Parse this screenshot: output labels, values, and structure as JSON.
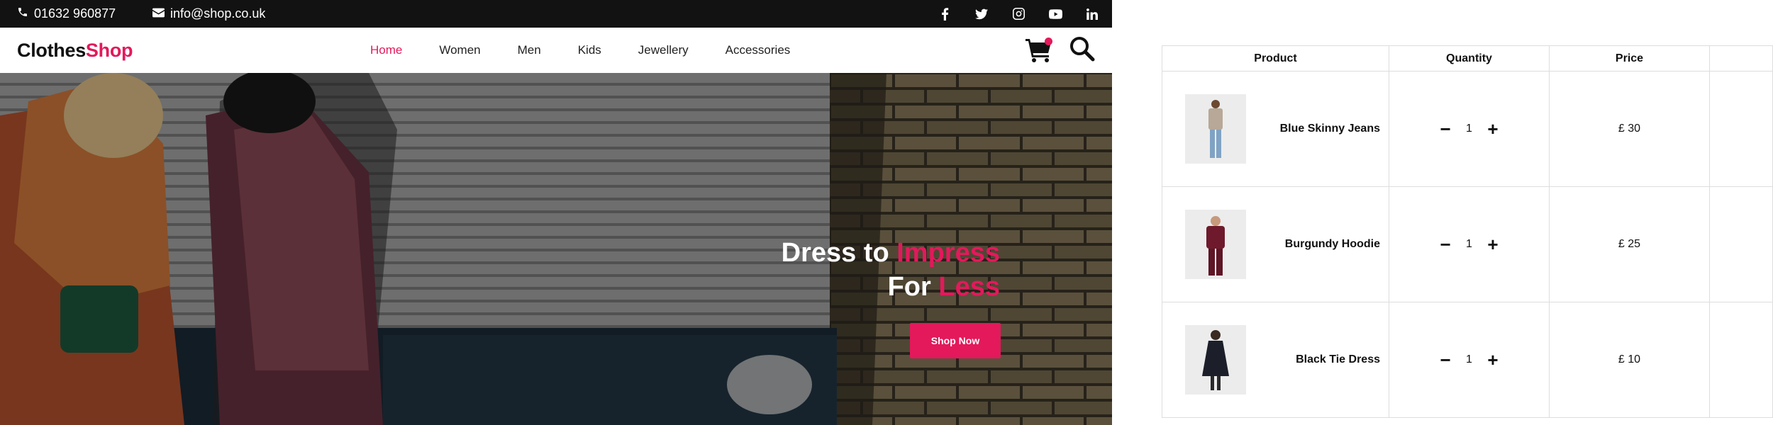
{
  "topbar": {
    "phone": "01632 960877",
    "email": "info@shop.co.uk",
    "social_icons": [
      "facebook-icon",
      "twitter-icon",
      "instagram-icon",
      "youtube-icon",
      "linkedin-icon"
    ]
  },
  "navbar": {
    "logo_part1": "Clothes",
    "logo_part2": "Shop",
    "menu": [
      "Home",
      "Women",
      "Men",
      "Kids",
      "Jewellery",
      "Accessories"
    ],
    "active": "Home"
  },
  "hero": {
    "line1_plain": "Dress to ",
    "line1_accent": "Impress",
    "line2_plain": "For ",
    "line2_accent": "Less",
    "button": "Shop Now"
  },
  "cart": {
    "headers": {
      "product": "Product",
      "quantity": "Quantity",
      "price": "Price"
    },
    "items": [
      {
        "name": "Blue Skinny Jeans",
        "qty": "1",
        "price": "£ 30"
      },
      {
        "name": "Burgundy Hoodie",
        "qty": "1",
        "price": "£ 25"
      },
      {
        "name": "Black Tie Dress",
        "qty": "1",
        "price": "£ 10"
      }
    ],
    "minus": "−",
    "plus": "+"
  },
  "colors": {
    "accent": "#e3195b",
    "topbar": "#121212"
  }
}
